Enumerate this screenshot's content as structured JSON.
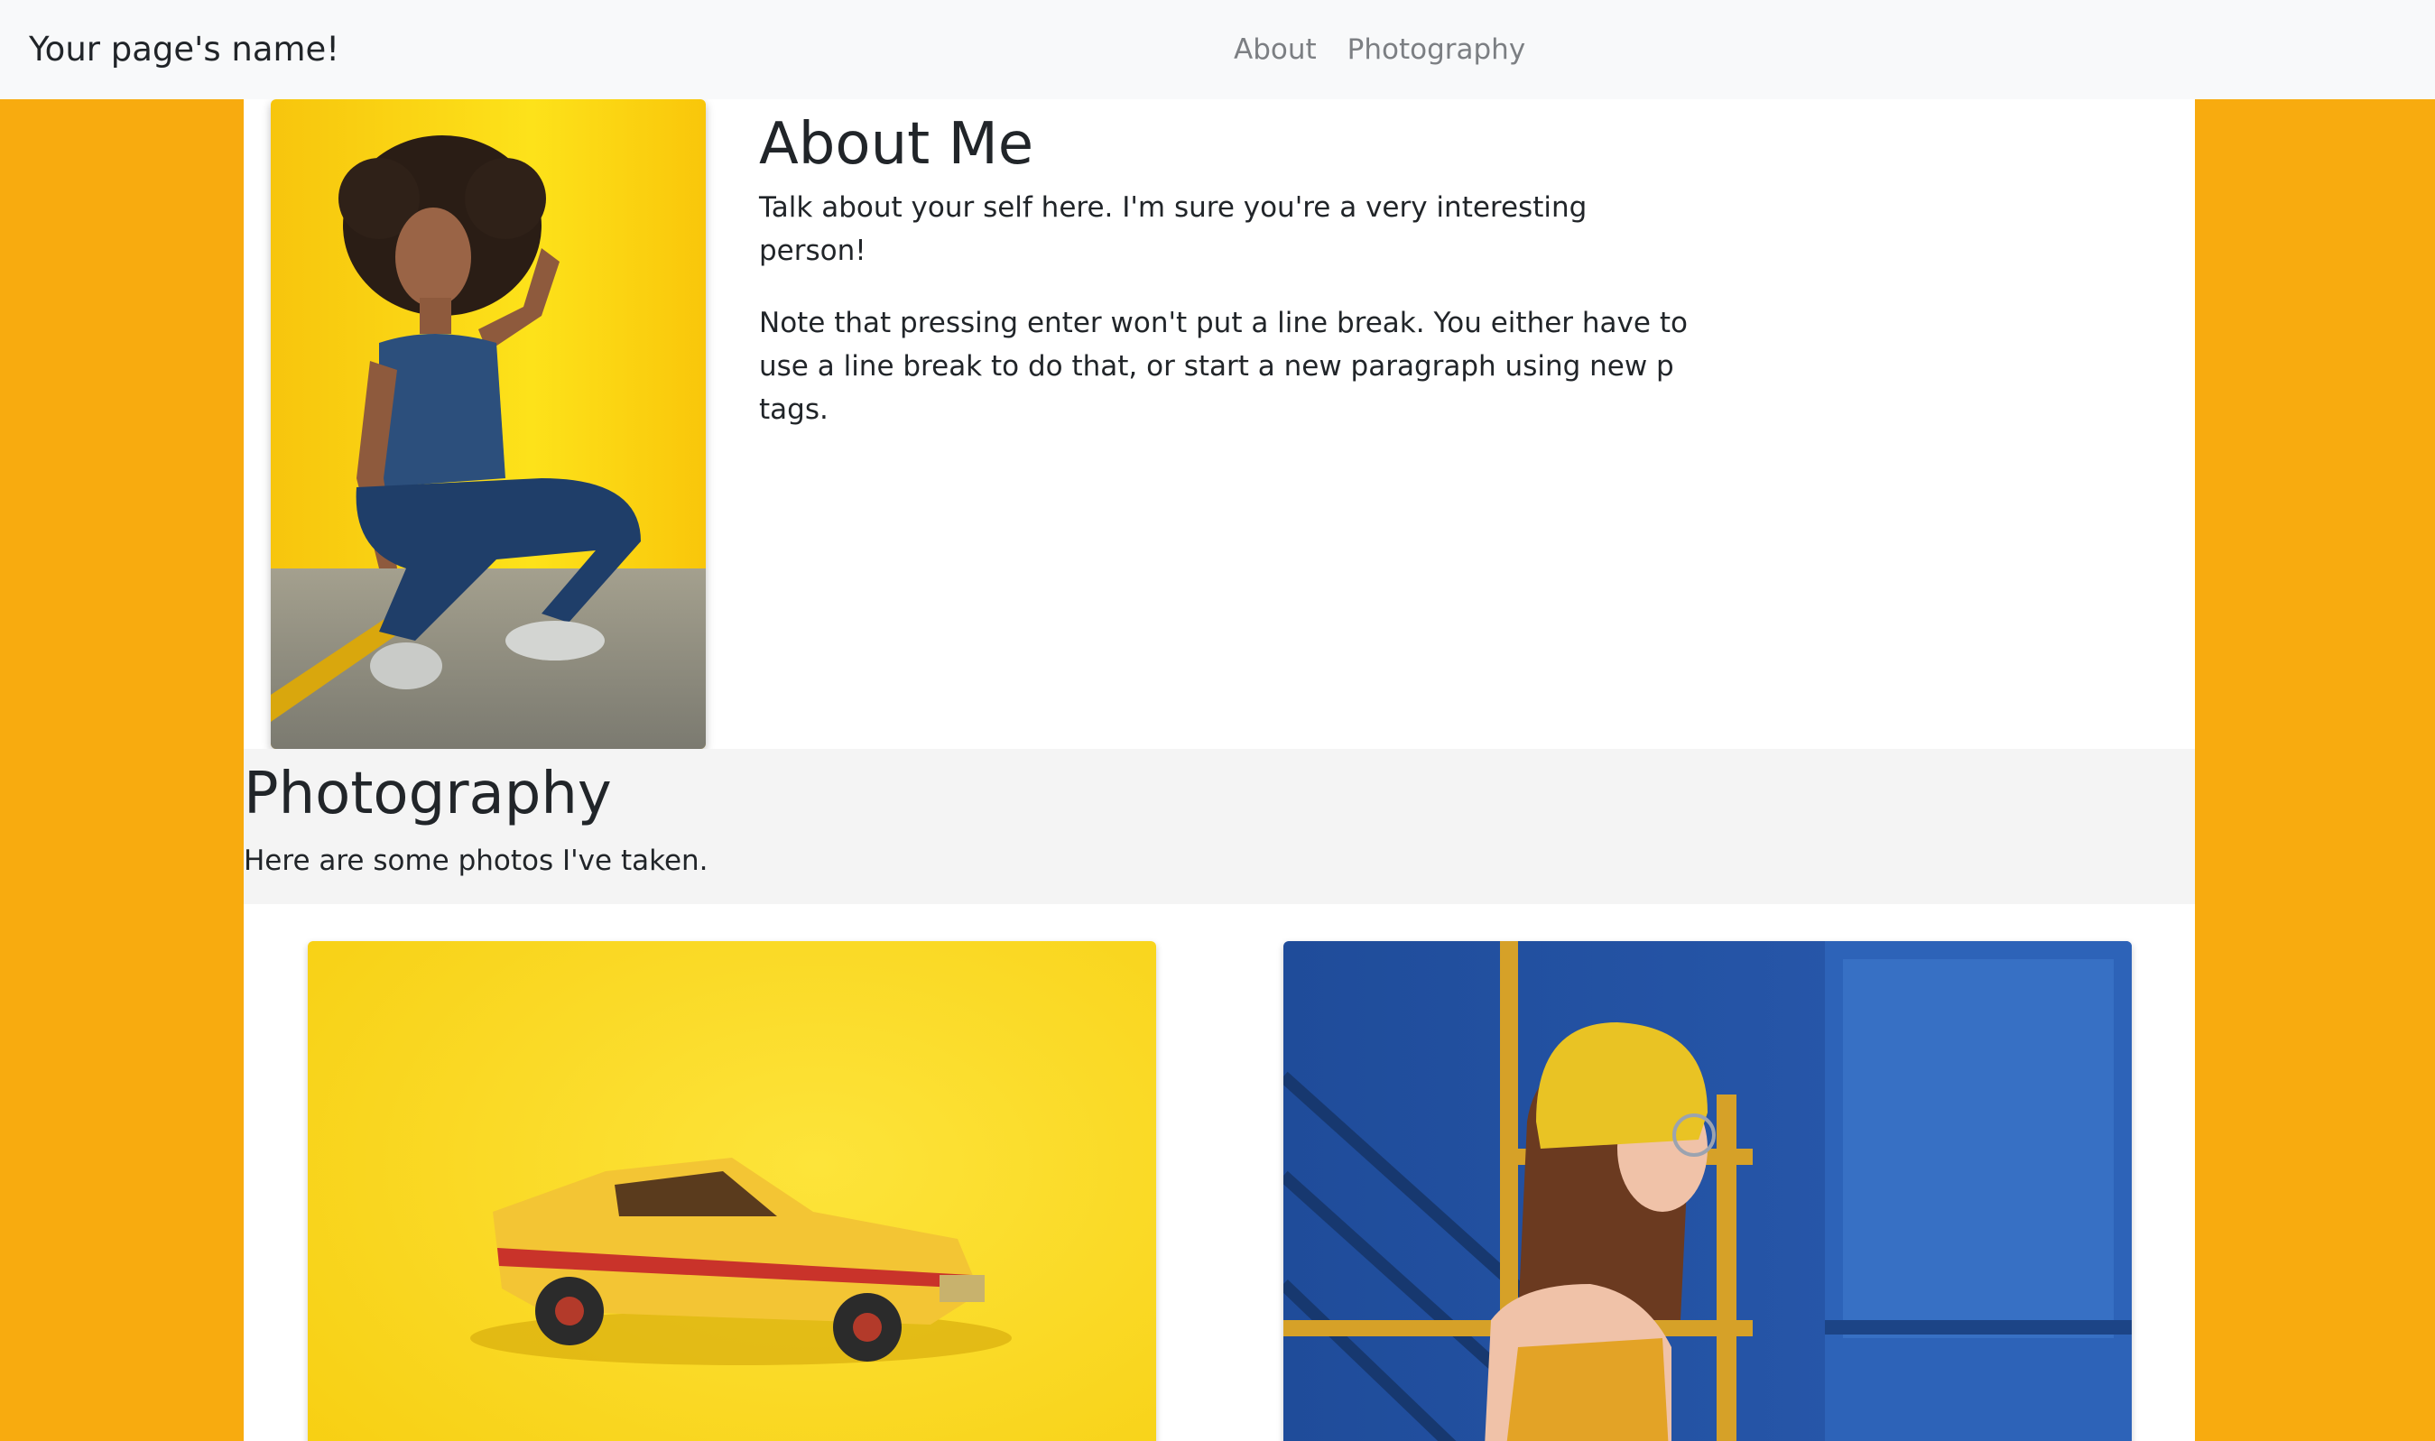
{
  "navbar": {
    "brand": "Your page's name!",
    "links": [
      {
        "label": "About"
      },
      {
        "label": "Photography"
      }
    ]
  },
  "about": {
    "title": "About Me",
    "paragraphs": [
      "Talk about your self here. I'm sure you're a very interesting person!",
      "Note that pressing enter won't put a line break. You either have to use a line break to do that, or start a new paragraph using new p tags."
    ]
  },
  "photography": {
    "title": "Photography",
    "subtitle": "Here are some photos I've taken."
  },
  "colors": {
    "page_background": "#f8ab0f",
    "navbar_background": "#f8f9fa",
    "content_background": "#ffffff",
    "band_background": "#f4f4f4",
    "text": "#212529",
    "nav_link": "#7c7f83"
  }
}
